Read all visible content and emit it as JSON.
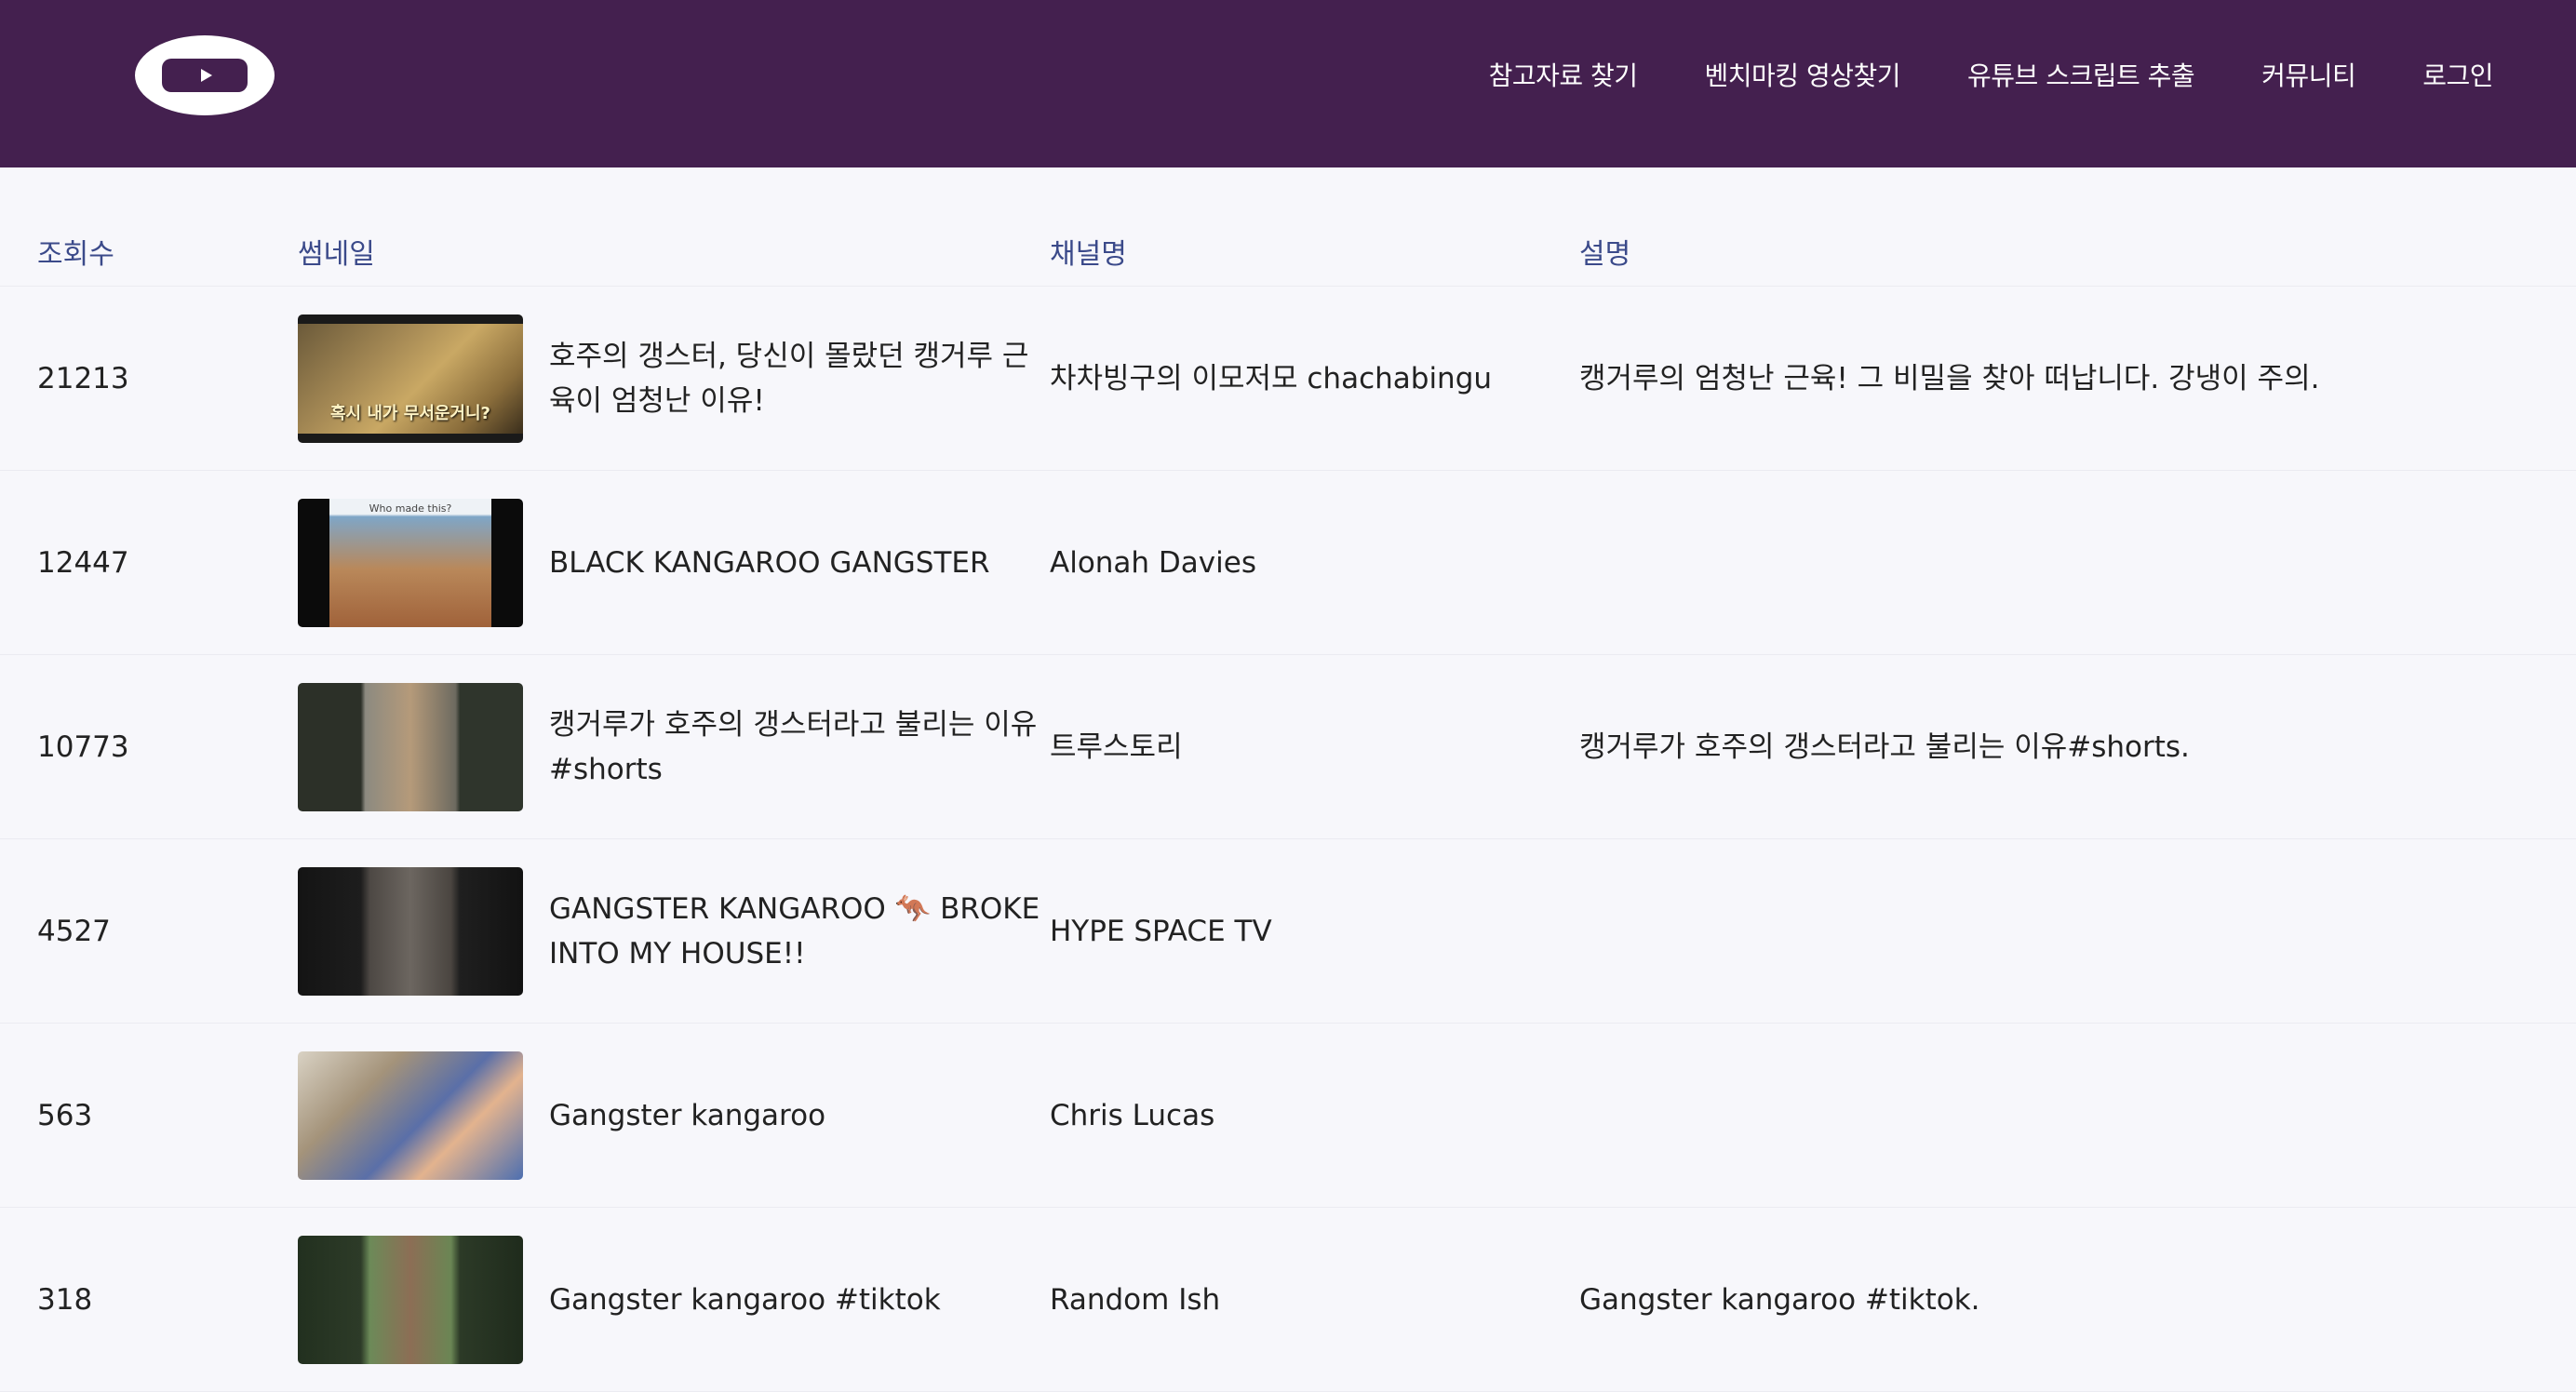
{
  "header": {
    "logo_icon": "youtube-play-icon",
    "colors": {
      "header_bg": "#44204f",
      "nav_text": "#ffffff",
      "column_header_text": "#3b4a8a"
    },
    "nav": [
      {
        "label": "참고자료 찾기"
      },
      {
        "label": "벤치마킹 영상찾기"
      },
      {
        "label": "유튜브 스크립트 추출"
      },
      {
        "label": "커뮤니티"
      },
      {
        "label": "로그인"
      }
    ]
  },
  "table": {
    "columns": {
      "views": "조회수",
      "thumbnail": "썸네일",
      "channel": "채널명",
      "description": "설명"
    },
    "rows": [
      {
        "views": "21213",
        "title": "호주의 갱스터, 당신이 몰랐던 캥거루 근육이 엄청난 이유!",
        "channel": "차차빙구의 이모저모 chachabingu",
        "description": "캥거루의 엄청난 근육! 그 비밀을 찾아 떠납니다. 강냉이 주의.",
        "thumb_text": "혹시 내가 무서운거니?"
      },
      {
        "views": "12447",
        "title": "BLACK KANGAROO GANGSTER",
        "channel": "Alonah Davies",
        "description": "",
        "thumb_text": "Who made this?"
      },
      {
        "views": "10773",
        "title": "캥거루가 호주의 갱스터라고 불리는 이유 #shorts",
        "channel": "트루스토리",
        "description": "캥거루가 호주의 갱스터라고 불리는 이유#shorts.",
        "thumb_text": ""
      },
      {
        "views": "4527",
        "title": "GANGSTER KANGAROO 🦘 BROKE INTO MY HOUSE!!",
        "channel": "HYPE SPACE TV",
        "description": "",
        "thumb_text": ""
      },
      {
        "views": "563",
        "title": "Gangster kangaroo",
        "channel": "Chris Lucas",
        "description": "",
        "thumb_text": ""
      },
      {
        "views": "318",
        "title": "Gangster kangaroo #tiktok",
        "channel": "Random Ish",
        "description": "Gangster kangaroo #tiktok.",
        "thumb_text": ""
      }
    ]
  }
}
